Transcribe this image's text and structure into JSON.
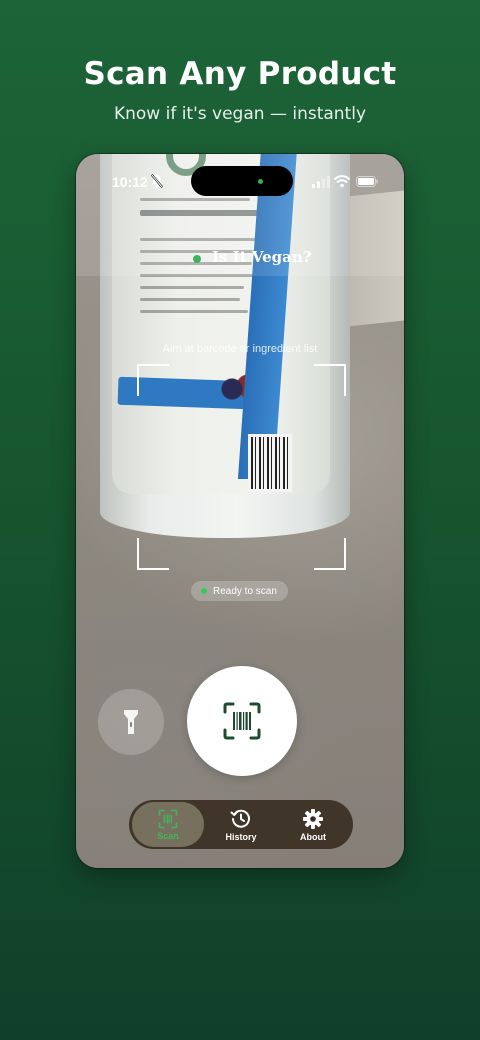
{
  "promo": {
    "headline": "Scan Any Product",
    "subheadline": "Know if it's vegan — instantly"
  },
  "status_bar": {
    "time": "10:12",
    "icons": [
      "bell-slash-icon",
      "signal-icon",
      "wifi-icon",
      "battery-icon"
    ]
  },
  "app": {
    "title": "Is It Vegan?",
    "scan_hint": "Aim at barcode or ingredient list",
    "status_label": "Ready to scan"
  },
  "controls": {
    "flashlight_icon": "flashlight-icon",
    "shutter_icon": "barcode-scan-icon"
  },
  "tabs": [
    {
      "label": "Scan",
      "icon": "barcode-scan-icon",
      "active": true
    },
    {
      "label": "History",
      "icon": "history-clock-icon",
      "active": false
    },
    {
      "label": "About",
      "icon": "gear-icon",
      "active": false
    }
  ],
  "colors": {
    "background_green": "#1b5e36",
    "accent_green": "#3fb35a",
    "tabbar_brown": "#372a1e",
    "shutter_icon": "#1e4a30"
  }
}
